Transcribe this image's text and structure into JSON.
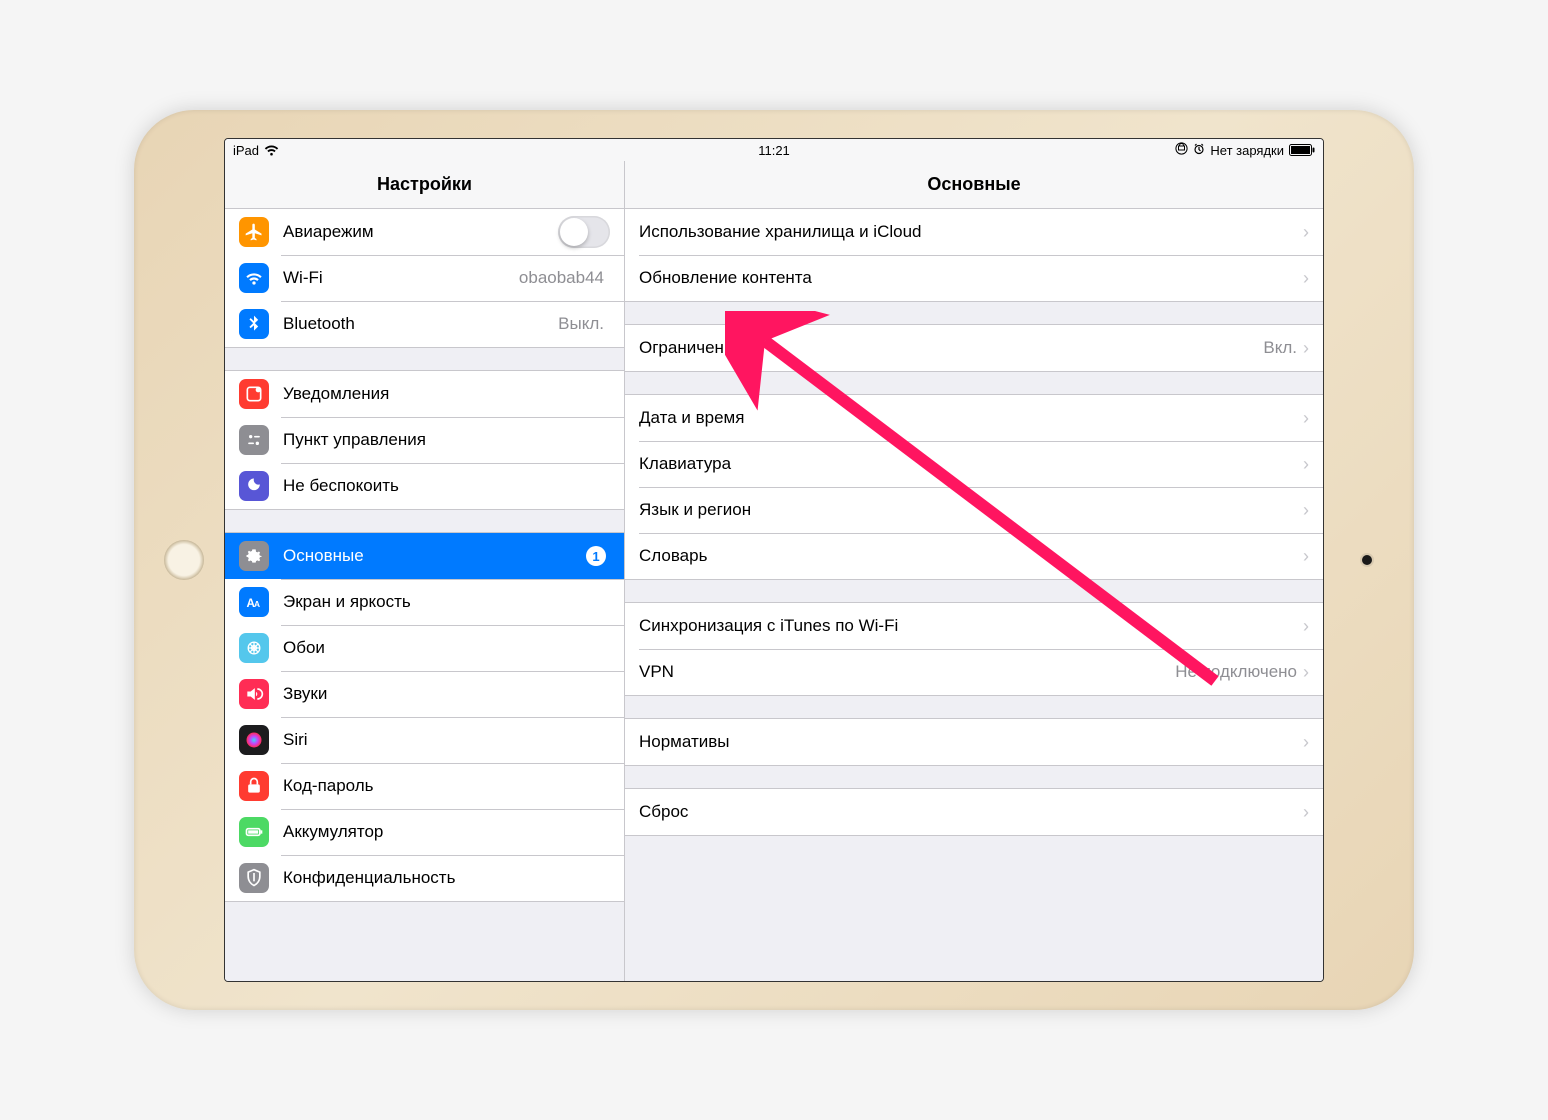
{
  "status": {
    "device": "iPad",
    "time": "11:21",
    "charging_text": "Нет зарядки"
  },
  "sidebar": {
    "title": "Настройки",
    "groups": [
      {
        "items": [
          {
            "id": "airplane",
            "label": "Авиарежим",
            "icon_bg": "#ff9500",
            "switch": true
          },
          {
            "id": "wifi",
            "label": "Wi-Fi",
            "icon_bg": "#007aff",
            "value": "obaobab44"
          },
          {
            "id": "bluetooth",
            "label": "Bluetooth",
            "icon_bg": "#007aff",
            "value": "Выкл."
          }
        ]
      },
      {
        "items": [
          {
            "id": "notifications",
            "label": "Уведомления",
            "icon_bg": "#ff3b30"
          },
          {
            "id": "control-center",
            "label": "Пункт управления",
            "icon_bg": "#8e8e93"
          },
          {
            "id": "dnd",
            "label": "Не беспокоить",
            "icon_bg": "#5856d6"
          }
        ]
      },
      {
        "items": [
          {
            "id": "general",
            "label": "Основные",
            "icon_bg": "#8e8e93",
            "badge": "1",
            "selected": true
          },
          {
            "id": "display",
            "label": "Экран и яркость",
            "icon_bg": "#007aff"
          },
          {
            "id": "wallpaper",
            "label": "Обои",
            "icon_bg": "#54c7ec"
          },
          {
            "id": "sounds",
            "label": "Звуки",
            "icon_bg": "#ff2d55"
          },
          {
            "id": "siri",
            "label": "Siri",
            "icon_bg": "#1c1c1e"
          },
          {
            "id": "passcode",
            "label": "Код-пароль",
            "icon_bg": "#ff3b30"
          },
          {
            "id": "battery",
            "label": "Аккумулятор",
            "icon_bg": "#4cd964"
          },
          {
            "id": "privacy",
            "label": "Конфиденциальность",
            "icon_bg": "#8e8e93"
          }
        ]
      }
    ]
  },
  "detail": {
    "title": "Основные",
    "groups": [
      {
        "items": [
          {
            "id": "storage",
            "label": "Использование хранилища и iCloud"
          },
          {
            "id": "background-refresh",
            "label": "Обновление контента"
          }
        ]
      },
      {
        "items": [
          {
            "id": "restrictions",
            "label": "Ограничения",
            "value": "Вкл."
          }
        ]
      },
      {
        "items": [
          {
            "id": "date-time",
            "label": "Дата и время"
          },
          {
            "id": "keyboard",
            "label": "Клавиатура"
          },
          {
            "id": "language-region",
            "label": "Язык и регион"
          },
          {
            "id": "dictionary",
            "label": "Словарь"
          }
        ]
      },
      {
        "items": [
          {
            "id": "itunes-wifi-sync",
            "label": "Синхронизация с iTunes по Wi-Fi"
          },
          {
            "id": "vpn",
            "label": "VPN",
            "value": "Не подключено"
          }
        ]
      },
      {
        "items": [
          {
            "id": "regulatory",
            "label": "Нормативы"
          }
        ]
      },
      {
        "items": [
          {
            "id": "reset",
            "label": "Сброс"
          }
        ]
      }
    ]
  }
}
